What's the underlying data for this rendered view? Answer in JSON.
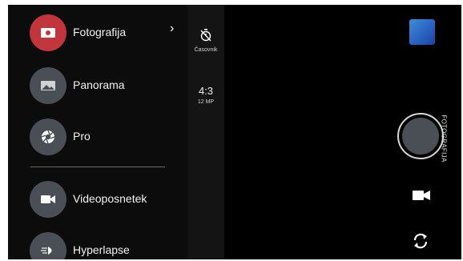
{
  "menu": {
    "modes": [
      {
        "label": "Fotografija",
        "icon": "photo-icon",
        "active": true
      },
      {
        "label": "Panorama",
        "icon": "panorama-icon",
        "active": false
      },
      {
        "label": "Pro",
        "icon": "aperture-icon",
        "active": false
      },
      {
        "label": "Videoposnetek",
        "icon": "video-camera-icon",
        "active": false
      },
      {
        "label": "Hyperlapse",
        "icon": "hyperlapse-icon",
        "active": false
      }
    ],
    "active_color": "#c2353c"
  },
  "settings": {
    "timer_label": "Časovnik",
    "ratio": "4:3",
    "megapixels": "12 MP"
  },
  "controls": {
    "mode_label": "FOTOGRAFIJA"
  }
}
